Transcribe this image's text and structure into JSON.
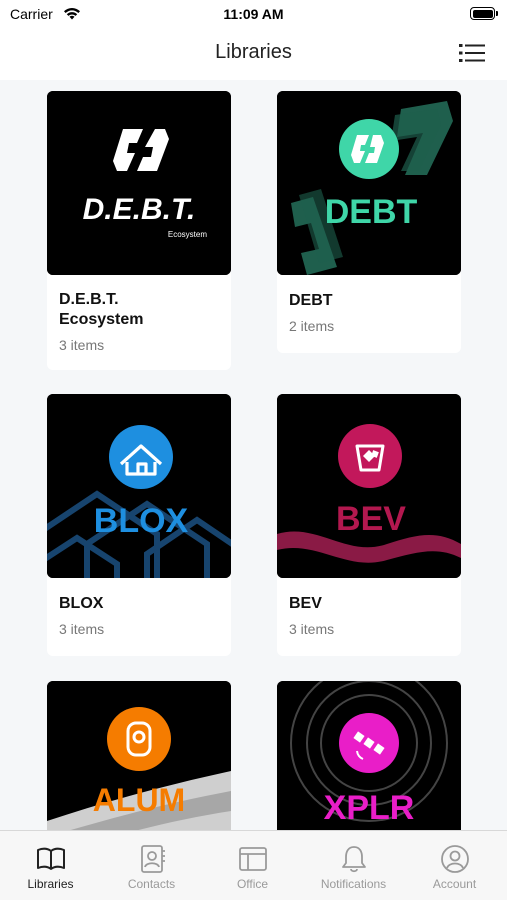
{
  "status_bar": {
    "carrier": "Carrier",
    "time": "11:09 AM"
  },
  "nav": {
    "title": "Libraries",
    "list_view_icon": "list-view-icon"
  },
  "libraries": [
    {
      "title": "D.E.B.T. Ecosystem",
      "subtitle": "3 items",
      "cover": {
        "wordmark": "D.E.B.T.",
        "tagline": "Ecosystem",
        "accent": "#ffffff"
      }
    },
    {
      "title": "DEBT",
      "subtitle": "2 items",
      "cover": {
        "wordmark": "DEBT",
        "accent": "#3fd6a8"
      }
    },
    {
      "title": "BLOX",
      "subtitle": "3 items",
      "cover": {
        "wordmark": "BLOX",
        "accent": "#1e8fe0"
      }
    },
    {
      "title": "BEV",
      "subtitle": "3 items",
      "cover": {
        "wordmark": "BEV",
        "accent": "#c2185b"
      }
    },
    {
      "title": "",
      "subtitle": "",
      "cover": {
        "wordmark": "ALUM",
        "accent": "#f57c00"
      }
    },
    {
      "title": "",
      "subtitle": "",
      "cover": {
        "wordmark": "XPLR",
        "accent": "#e91ec8"
      }
    }
  ],
  "tabs": [
    {
      "label": "Libraries",
      "icon": "book-icon",
      "active": true
    },
    {
      "label": "Contacts",
      "icon": "contacts-icon",
      "active": false
    },
    {
      "label": "Office",
      "icon": "office-icon",
      "active": false
    },
    {
      "label": "Notifications",
      "icon": "bell-icon",
      "active": false
    },
    {
      "label": "Account",
      "icon": "account-icon",
      "active": false
    }
  ],
  "colors": {
    "background": "#f5f7f9",
    "active_tab": "#222222",
    "inactive_tab": "#9a9a9a"
  }
}
